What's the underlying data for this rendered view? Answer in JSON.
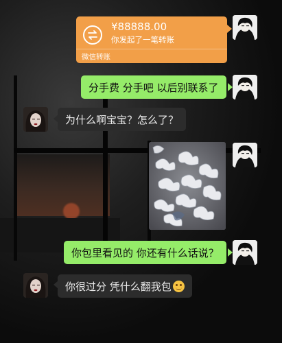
{
  "transfer": {
    "amount": "¥88888.00",
    "description": "你发起了一笔转账",
    "footer": "微信转账",
    "icon": "transfer-arrows-icon",
    "color": "#f29f48"
  },
  "messages": [
    {
      "side": "right",
      "text": "分手费 分手吧 以后别联系了"
    },
    {
      "side": "left",
      "text": "为什么啊宝宝？怎么了？"
    },
    {
      "side": "right",
      "type": "image",
      "description": ""
    },
    {
      "side": "right",
      "text": "你包里看见的 你还有什么话说？"
    },
    {
      "side": "left",
      "text": "你很过分 凭什么翻我包",
      "emoji": "smiling-face-icon"
    }
  ],
  "colors": {
    "sent_bubble": "#95ec69",
    "received_bubble": "#2c2c2c",
    "background": "#0c0c0c"
  }
}
